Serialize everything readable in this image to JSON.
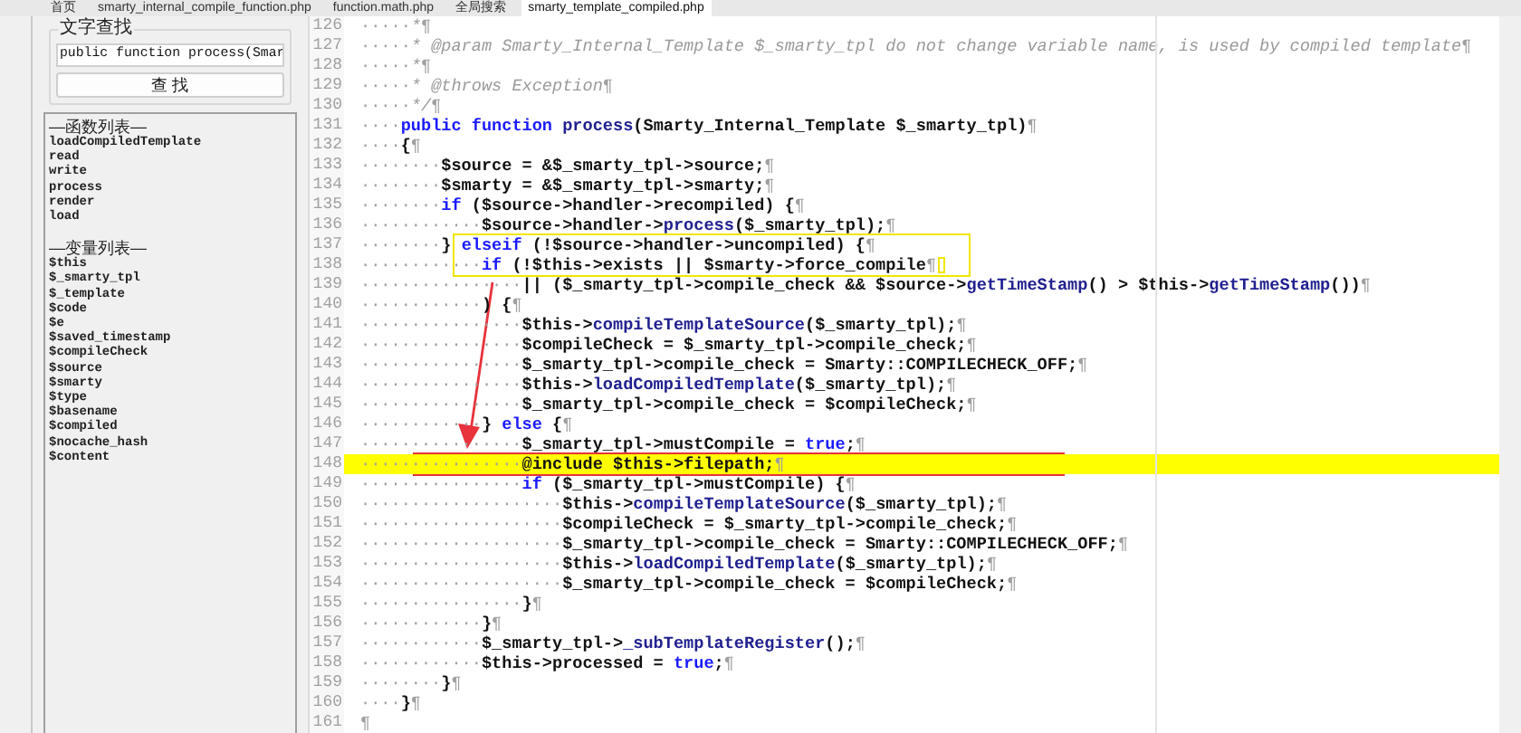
{
  "tabs": [
    {
      "label": "首页",
      "selected": false
    },
    {
      "label": "smarty_internal_compile_function.php",
      "selected": false
    },
    {
      "label": "function.math.php",
      "selected": false
    },
    {
      "label": "全局搜索",
      "selected": false
    },
    {
      "label": "smarty_template_compiled.php",
      "selected": true
    }
  ],
  "search": {
    "title": "文字查找",
    "value": "public function process(Smar",
    "button": "查 找"
  },
  "outline": [
    {
      "title": "—函数列表—",
      "items": [
        "loadCompiledTemplate",
        "read",
        "write",
        "process",
        "render",
        "load"
      ]
    },
    {
      "title": "—变量列表—",
      "items": [
        "$this",
        "$_smarty_tpl",
        "$_template",
        "$code",
        "$e",
        "$saved_timestamp",
        "$compileCheck",
        "$source",
        "$smarty",
        "$type",
        "$basename",
        "$compiled",
        "$nocache_hash",
        "$content"
      ]
    }
  ],
  "editor": {
    "lines": [
      {
        "number": "126",
        "indent": "·····",
        "tokens": [
          {
            "kind": "comment",
            "text": "*"
          }
        ]
      },
      {
        "number": "127",
        "indent": "·····",
        "tokens": [
          {
            "kind": "comment",
            "text": "* @param Smarty_Internal_Template $_smarty_tpl do not change variable name, is used by compiled template"
          }
        ]
      },
      {
        "number": "128",
        "indent": "·····",
        "tokens": [
          {
            "kind": "comment",
            "text": "*"
          }
        ]
      },
      {
        "number": "129",
        "indent": "·····",
        "tokens": [
          {
            "kind": "comment",
            "text": "* @throws Exception"
          }
        ]
      },
      {
        "number": "130",
        "indent": "·····",
        "tokens": [
          {
            "kind": "comment",
            "text": "*/"
          }
        ]
      },
      {
        "number": "131",
        "indent": "····",
        "tokens": [
          {
            "kind": "keyword",
            "text": "public function "
          },
          {
            "kind": "method",
            "text": "process"
          },
          {
            "kind": "plain",
            "text": "(Smarty_Internal_Template $_smarty_tpl)"
          }
        ]
      },
      {
        "number": "132",
        "indent": "····",
        "tokens": [
          {
            "kind": "plain",
            "text": "{"
          }
        ]
      },
      {
        "number": "133",
        "indent": "········",
        "tokens": [
          {
            "kind": "plain",
            "text": "$source = &$_smarty_tpl->source;"
          }
        ]
      },
      {
        "number": "134",
        "indent": "········",
        "tokens": [
          {
            "kind": "plain",
            "text": "$smarty = &$_smarty_tpl->smarty;"
          }
        ]
      },
      {
        "number": "135",
        "indent": "········",
        "tokens": [
          {
            "kind": "keyword",
            "text": "if"
          },
          {
            "kind": "plain",
            "text": " ($source->handler->recompiled) {"
          }
        ]
      },
      {
        "number": "136",
        "indent": "············",
        "tokens": [
          {
            "kind": "plain",
            "text": "$source->handler->"
          },
          {
            "kind": "method",
            "text": "process"
          },
          {
            "kind": "plain",
            "text": "($_smarty_tpl);"
          }
        ]
      },
      {
        "number": "137",
        "indent": "········",
        "tokens": [
          {
            "kind": "plain",
            "text": "} "
          },
          {
            "kind": "keyword",
            "text": "elseif"
          },
          {
            "kind": "plain",
            "text": " (!$source->handler->uncompiled) {"
          }
        ]
      },
      {
        "number": "138",
        "indent": "············",
        "caret": true,
        "tokens": [
          {
            "kind": "keyword",
            "text": "if"
          },
          {
            "kind": "plain",
            "text": " (!$this->exists || $smarty->force_compile"
          }
        ]
      },
      {
        "number": "139",
        "indent": "················",
        "tokens": [
          {
            "kind": "plain",
            "text": "|| ($_smarty_tpl->compile_check && $source->"
          },
          {
            "kind": "method",
            "text": "getTimeStamp"
          },
          {
            "kind": "plain",
            "text": "() > $this->"
          },
          {
            "kind": "method",
            "text": "getTimeStamp"
          },
          {
            "kind": "plain",
            "text": "())"
          }
        ]
      },
      {
        "number": "140",
        "indent": "············",
        "tokens": [
          {
            "kind": "plain",
            "text": ") {"
          }
        ]
      },
      {
        "number": "141",
        "indent": "················",
        "tokens": [
          {
            "kind": "plain",
            "text": "$this->"
          },
          {
            "kind": "method",
            "text": "compileTemplateSource"
          },
          {
            "kind": "plain",
            "text": "($_smarty_tpl);"
          }
        ]
      },
      {
        "number": "142",
        "indent": "················",
        "tokens": [
          {
            "kind": "plain",
            "text": "$compileCheck = $_smarty_tpl->compile_check;"
          }
        ]
      },
      {
        "number": "143",
        "indent": "················",
        "tokens": [
          {
            "kind": "plain",
            "text": "$_smarty_tpl->compile_check = Smarty::COMPILECHECK_OFF;"
          }
        ]
      },
      {
        "number": "144",
        "indent": "················",
        "tokens": [
          {
            "kind": "plain",
            "text": "$this->"
          },
          {
            "kind": "method",
            "text": "loadCompiledTemplate"
          },
          {
            "kind": "plain",
            "text": "($_smarty_tpl);"
          }
        ]
      },
      {
        "number": "145",
        "indent": "················",
        "tokens": [
          {
            "kind": "plain",
            "text": "$_smarty_tpl->compile_check = $compileCheck;"
          }
        ]
      },
      {
        "number": "146",
        "indent": "············",
        "tokens": [
          {
            "kind": "plain",
            "text": "} "
          },
          {
            "kind": "keyword",
            "text": "else"
          },
          {
            "kind": "plain",
            "text": " {"
          }
        ]
      },
      {
        "number": "147",
        "indent": "················",
        "tokens": [
          {
            "kind": "plain",
            "text": "$_smarty_tpl->mustCompile = "
          },
          {
            "kind": "keyword",
            "text": "true"
          },
          {
            "kind": "plain",
            "text": ";"
          }
        ]
      },
      {
        "number": "148",
        "indent": "················",
        "highlighted": true,
        "tokens": [
          {
            "kind": "plain",
            "text": "@include $this->filepath;"
          }
        ]
      },
      {
        "number": "149",
        "indent": "················",
        "tokens": [
          {
            "kind": "keyword",
            "text": "if"
          },
          {
            "kind": "plain",
            "text": " ($_smarty_tpl->mustCompile) {"
          }
        ]
      },
      {
        "number": "150",
        "indent": "····················",
        "tokens": [
          {
            "kind": "plain",
            "text": "$this->"
          },
          {
            "kind": "method",
            "text": "compileTemplateSource"
          },
          {
            "kind": "plain",
            "text": "($_smarty_tpl);"
          }
        ]
      },
      {
        "number": "151",
        "indent": "····················",
        "tokens": [
          {
            "kind": "plain",
            "text": "$compileCheck = $_smarty_tpl->compile_check;"
          }
        ]
      },
      {
        "number": "152",
        "indent": "····················",
        "tokens": [
          {
            "kind": "plain",
            "text": "$_smarty_tpl->compile_check = Smarty::COMPILECHECK_OFF;"
          }
        ]
      },
      {
        "number": "153",
        "indent": "····················",
        "tokens": [
          {
            "kind": "plain",
            "text": "$this->"
          },
          {
            "kind": "method",
            "text": "loadCompiledTemplate"
          },
          {
            "kind": "plain",
            "text": "($_smarty_tpl);"
          }
        ]
      },
      {
        "number": "154",
        "indent": "····················",
        "tokens": [
          {
            "kind": "plain",
            "text": "$_smarty_tpl->compile_check = $compileCheck;"
          }
        ]
      },
      {
        "number": "155",
        "indent": "················",
        "tokens": [
          {
            "kind": "plain",
            "text": "}"
          }
        ]
      },
      {
        "number": "156",
        "indent": "············",
        "tokens": [
          {
            "kind": "plain",
            "text": "}"
          }
        ]
      },
      {
        "number": "157",
        "indent": "············",
        "tokens": [
          {
            "kind": "plain",
            "text": "$_smarty_tpl->"
          },
          {
            "kind": "method",
            "text": "_subTemplateRegister"
          },
          {
            "kind": "plain",
            "text": "();"
          }
        ]
      },
      {
        "number": "158",
        "indent": "············",
        "tokens": [
          {
            "kind": "plain",
            "text": "$this->processed = "
          },
          {
            "kind": "keyword",
            "text": "true"
          },
          {
            "kind": "plain",
            "text": ";"
          }
        ]
      },
      {
        "number": "159",
        "indent": "········",
        "tokens": [
          {
            "kind": "plain",
            "text": "}"
          }
        ]
      },
      {
        "number": "160",
        "indent": "····",
        "tokens": [
          {
            "kind": "plain",
            "text": "}"
          }
        ]
      },
      {
        "number": "161"
      }
    ],
    "eol": "¶"
  },
  "annotations": [
    {
      "kind": "box",
      "color": "#f2e600"
    },
    {
      "kind": "box",
      "color": "#e8323c"
    },
    {
      "kind": "arrow",
      "color": "#e8323c"
    }
  ]
}
